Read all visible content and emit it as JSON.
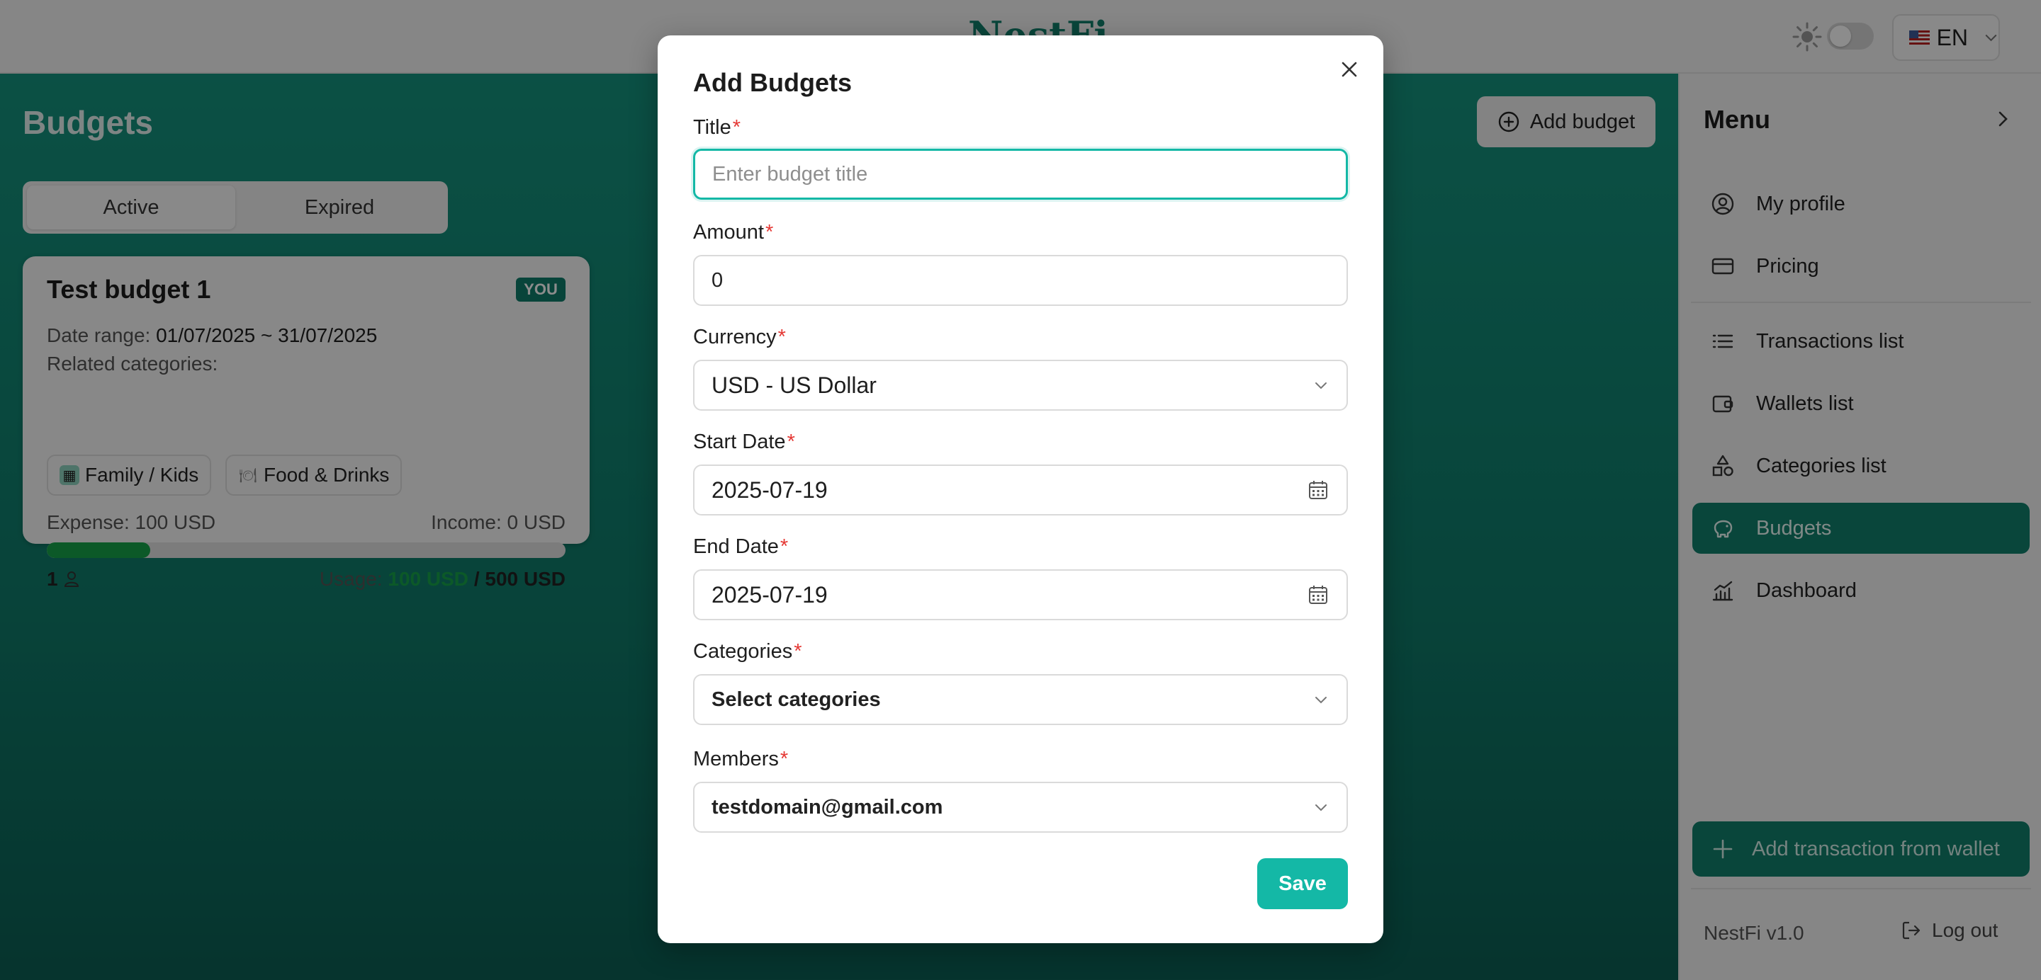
{
  "header": {
    "logo": "NestFi",
    "language": "EN"
  },
  "page": {
    "title": "Budgets",
    "add_budget_label": "Add budget",
    "tabs": [
      {
        "label": "Active",
        "selected": true
      },
      {
        "label": "Expired",
        "selected": false
      }
    ]
  },
  "budget_card": {
    "title": "Test budget 1",
    "badge": "YOU",
    "date_range_label": "Date range:",
    "date_range_value": "01/07/2025 ~ 31/07/2025",
    "related_label": "Related categories:",
    "categories": [
      {
        "emoji": "👨‍👩‍👧",
        "label": "Family / Kids"
      },
      {
        "emoji": "🍽",
        "label": "Food & Drinks"
      }
    ],
    "expense": "Expense: 100 USD",
    "income": "Income: 0 USD",
    "progress_percent": 20,
    "members_count": "1",
    "usage_label": "Usage:",
    "usage_used": "100 USD",
    "usage_separator": "/",
    "usage_total": "500 USD"
  },
  "sidebar": {
    "title": "Menu",
    "items": [
      {
        "label": "My profile",
        "icon": "user-circle-icon"
      },
      {
        "label": "Pricing",
        "icon": "credit-card-icon"
      },
      {
        "label": "Transactions list",
        "icon": "list-icon"
      },
      {
        "label": "Wallets list",
        "icon": "wallet-icon"
      },
      {
        "label": "Categories list",
        "icon": "shapes-icon"
      },
      {
        "label": "Budgets",
        "icon": "piggy-bank-icon",
        "active": true
      },
      {
        "label": "Dashboard",
        "icon": "chart-icon"
      }
    ],
    "add_transaction_label": "Add transaction from wallet",
    "version": "NestFi v1.0",
    "logout_label": "Log out"
  },
  "modal": {
    "title": "Add Budgets",
    "fields": {
      "title": {
        "label": "Title",
        "required": "*",
        "placeholder": "Enter budget title",
        "value": ""
      },
      "amount": {
        "label": "Amount",
        "required": "*",
        "value": "0"
      },
      "currency": {
        "label": "Currency",
        "required": "*",
        "value": "USD - US Dollar"
      },
      "start_date": {
        "label": "Start Date",
        "required": "*",
        "value": "2025-07-19"
      },
      "end_date": {
        "label": "End Date",
        "required": "*",
        "value": "2025-07-19"
      },
      "categories": {
        "label": "Categories",
        "required": "*",
        "value": "Select categories"
      },
      "members": {
        "label": "Members",
        "required": "*",
        "value": "testdomain@gmail.com"
      }
    },
    "save_label": "Save"
  },
  "colors": {
    "brand": "#12806c",
    "accent": "#14b8a6",
    "usage_green": "#16a34a",
    "required": "#e53935"
  }
}
